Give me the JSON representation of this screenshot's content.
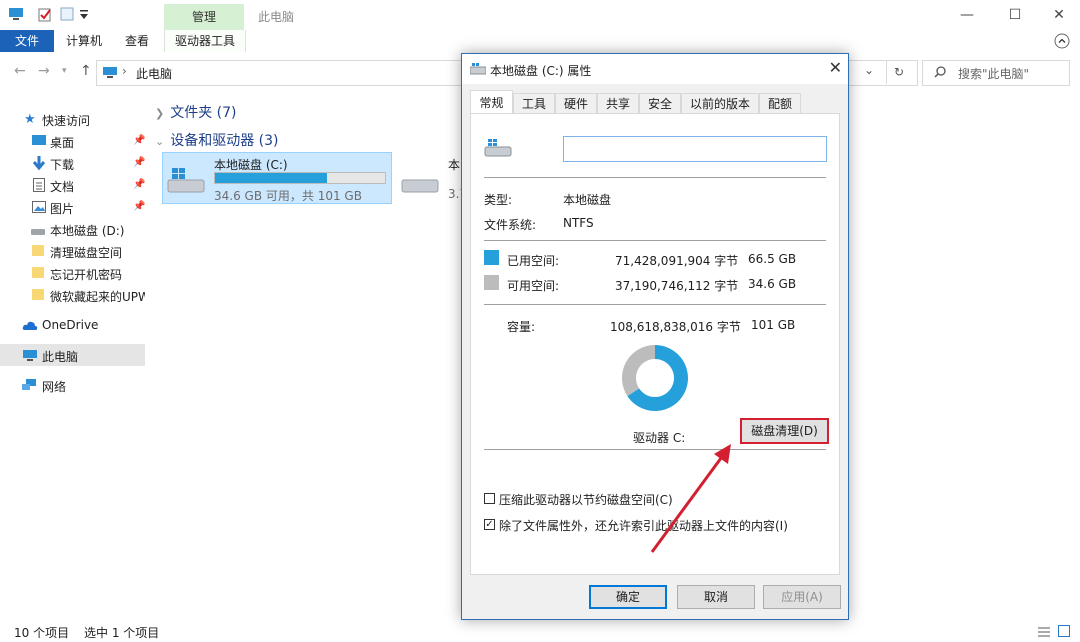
{
  "window": {
    "title": "此电脑",
    "context_tab": "管理",
    "controls": {
      "minimize": "—",
      "maximize": "☐",
      "close": "✕"
    }
  },
  "ribbon": {
    "file": "文件",
    "computer": "计算机",
    "view": "查看",
    "drive_tools": "驱动器工具"
  },
  "address": {
    "path": "此电脑",
    "separator": "›",
    "search_placeholder": "搜索\"此电脑\""
  },
  "nav": {
    "quick_access": "快速访问",
    "items": [
      {
        "label": "桌面",
        "pinned": true
      },
      {
        "label": "下载",
        "pinned": true
      },
      {
        "label": "文档",
        "pinned": true
      },
      {
        "label": "图片",
        "pinned": true
      },
      {
        "label": "本地磁盘 (D:)"
      },
      {
        "label": "清理磁盘空间"
      },
      {
        "label": "忘记开机密码"
      },
      {
        "label": "微软藏起来的UPW"
      }
    ],
    "onedrive": "OneDrive",
    "this_pc": "此电脑",
    "network": "网络"
  },
  "content": {
    "folders_group": "文件夹 (7)",
    "devices_group": "设备和驱动器 (3)",
    "drive_c": {
      "name": "本地磁盘 (C:)",
      "free_text": "34.6 GB 可用，共 101 GB",
      "used_fraction": 0.66
    },
    "drive_2": {
      "name_partial": "本",
      "free_partial": "3.7"
    }
  },
  "status": {
    "count": "10 个项目",
    "selected": "选中 1 个项目"
  },
  "dialog": {
    "title": "本地磁盘 (C:) 属性",
    "tabs": [
      "常规",
      "工具",
      "硬件",
      "共享",
      "安全",
      "以前的版本",
      "配额"
    ],
    "active_tab": "常规",
    "name_value": "",
    "type_label": "类型:",
    "type_value": "本地磁盘",
    "fs_label": "文件系统:",
    "fs_value": "NTFS",
    "used_label": "已用空间:",
    "used_bytes": "71,428,091,904 字节",
    "used_size": "66.5 GB",
    "free_label": "可用空间:",
    "free_bytes": "37,190,746,112 字节",
    "free_size": "34.6 GB",
    "capacity_label": "容量:",
    "capacity_bytes": "108,618,838,016 字节",
    "capacity_size": "101 GB",
    "drive_label": "驱动器 C:",
    "cleanup_button": "磁盘清理(D)",
    "compress_option": "压缩此驱动器以节约磁盘空间(C)",
    "compress_checked": false,
    "index_option": "除了文件属性外，还允许索引此驱动器上文件的内容(I)",
    "index_checked": true,
    "ok_button": "确定",
    "cancel_button": "取消",
    "apply_button": "应用(A)",
    "used_color": "#26a0da",
    "free_color": "#bcbcbc"
  },
  "annotation": {
    "arrow_color": "#d31f2f",
    "highlight_color": "#d31f2f"
  },
  "chart_data": {
    "type": "pie",
    "categories": [
      "已用空间",
      "可用空间"
    ],
    "values": [
      66.5,
      34.6
    ],
    "colors": [
      "#26a0da",
      "#bcbcbc"
    ]
  }
}
